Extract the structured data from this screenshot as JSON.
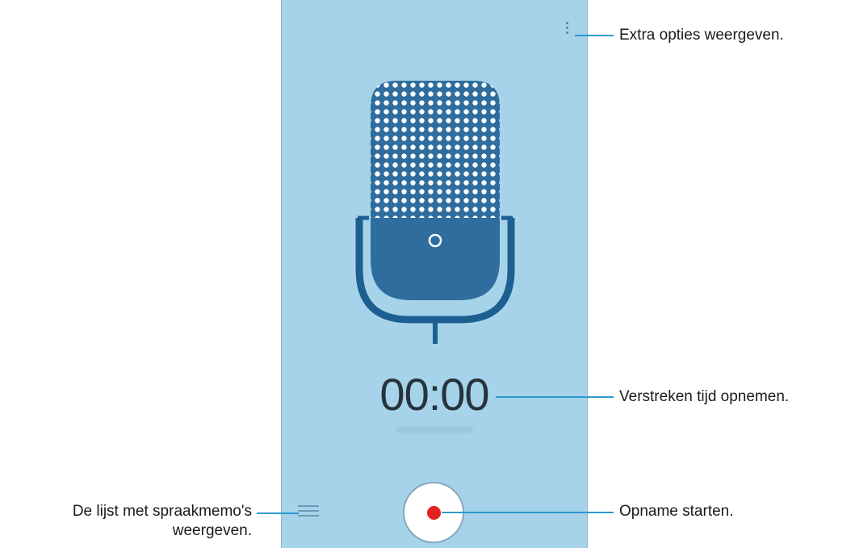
{
  "screen": {
    "timer": "00:00",
    "icons": {
      "more_options": "more-options-vertical-dots-icon",
      "microphone": "microphone-icon",
      "list": "list-icon",
      "record": "record-icon"
    },
    "colors": {
      "background": "#a7d3ea",
      "microphone": "#2f6d9e",
      "record_dot": "#e3211d"
    }
  },
  "callouts": {
    "options": "Extra opties weergeven.",
    "elapsed": "Verstreken tijd opnemen.",
    "list_line1": "De lijst met spraakmemo's",
    "list_line2": "weergeven.",
    "record": "Opname starten."
  }
}
